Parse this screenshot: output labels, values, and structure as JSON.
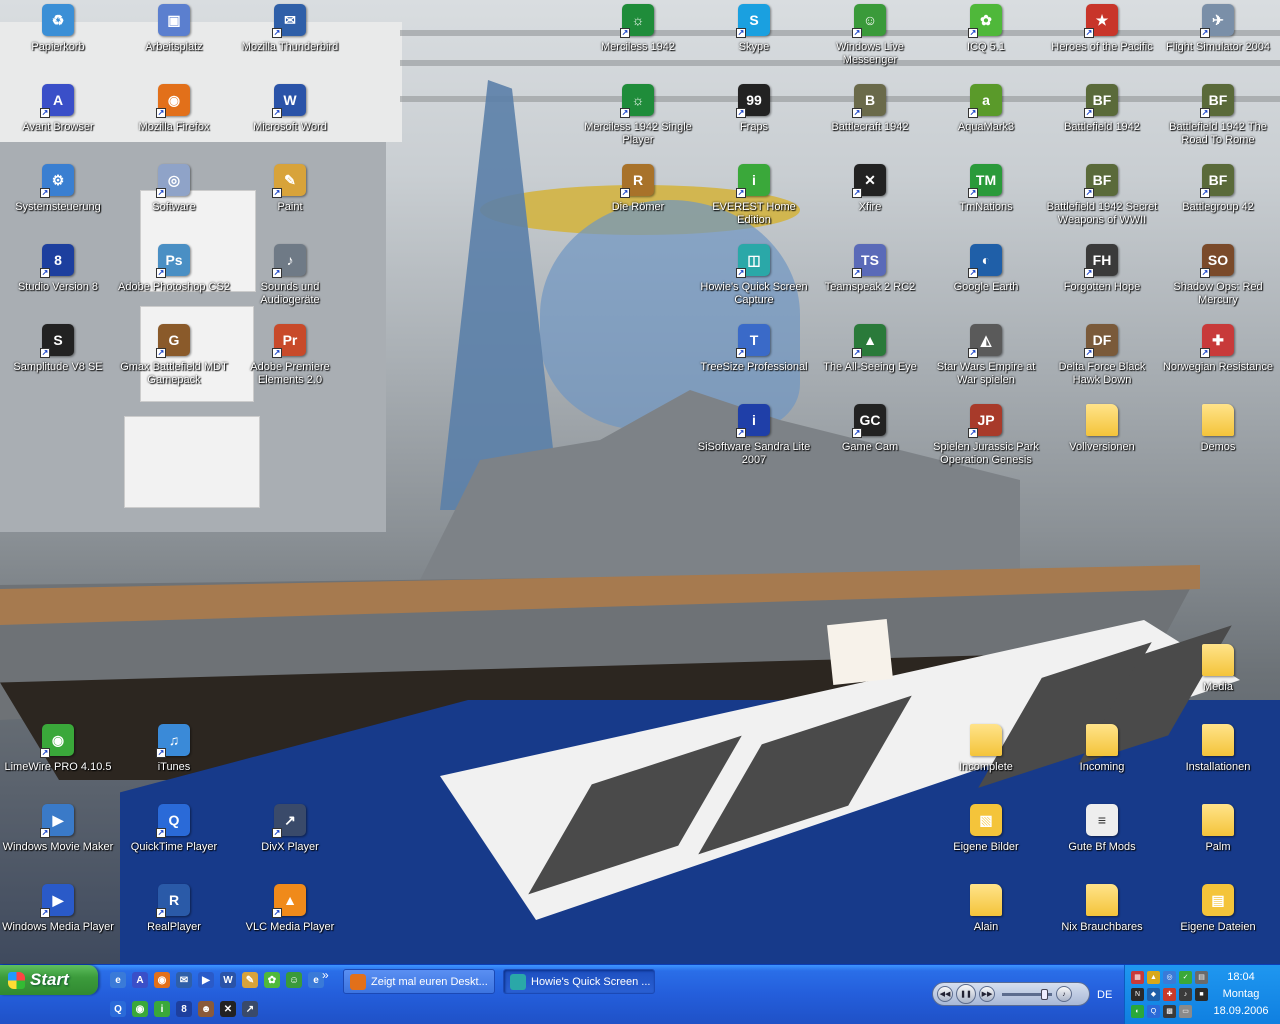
{
  "desktop": {
    "icons": [
      {
        "label": "Papierkorb",
        "icon": "recycle-bin-icon",
        "color": "#3b8fd6",
        "glyph": "♻",
        "shortcut": false
      },
      {
        "label": "Arbeitsplatz",
        "icon": "my-computer-icon",
        "color": "#5b7fcf",
        "glyph": "▣",
        "shortcut": false
      },
      {
        "label": "Mozilla Thunderbird",
        "icon": "thunderbird-icon",
        "color": "#2f5fa8",
        "glyph": "✉",
        "shortcut": true
      },
      {
        "label": "Avant Browser",
        "icon": "avant-browser-icon",
        "color": "#3a4fc8",
        "glyph": "A",
        "shortcut": true
      },
      {
        "label": "Mozilla Firefox",
        "icon": "firefox-icon",
        "color": "#e2701a",
        "glyph": "◉",
        "shortcut": true
      },
      {
        "label": "Microsoft Word",
        "icon": "word-icon",
        "color": "#2a53a8",
        "glyph": "W",
        "shortcut": true
      },
      {
        "label": "Systemsteuerung",
        "icon": "control-panel-icon",
        "color": "#3a7fd1",
        "glyph": "⚙",
        "shortcut": true
      },
      {
        "label": "Software",
        "icon": "software-cd-icon",
        "color": "#8fa3c8",
        "glyph": "◎",
        "shortcut": true
      },
      {
        "label": "Paint",
        "icon": "paint-icon",
        "color": "#d8a33a",
        "glyph": "✎",
        "shortcut": true
      },
      {
        "label": "Studio Version 8",
        "icon": "studio-icon",
        "color": "#1d3f9e",
        "glyph": "8",
        "shortcut": true
      },
      {
        "label": "Adobe Photoshop CS2",
        "icon": "photoshop-icon",
        "color": "#4a8fc4",
        "glyph": "Ps",
        "shortcut": true
      },
      {
        "label": "Sounds und Audiogeräte",
        "icon": "speaker-icon",
        "color": "#6f7a86",
        "glyph": "♪",
        "shortcut": true
      },
      {
        "label": "Samplitude V8 SE",
        "icon": "samplitude-icon",
        "color": "#222222",
        "glyph": "S",
        "shortcut": true
      },
      {
        "label": "Gmax Battlefield MDT Gamepack",
        "icon": "gmax-icon",
        "color": "#8a5a2a",
        "glyph": "G",
        "shortcut": true
      },
      {
        "label": "Adobe Premiere Elements 2.0",
        "icon": "premiere-icon",
        "color": "#c84a2a",
        "glyph": "Pr",
        "shortcut": true
      },
      {
        "label": "Merciless 1942",
        "icon": "merciless-icon",
        "color": "#1f8c3a",
        "glyph": "☼",
        "shortcut": true
      },
      {
        "label": "Skype",
        "icon": "skype-icon",
        "color": "#1aa0e0",
        "glyph": "S",
        "shortcut": true
      },
      {
        "label": "Windows Live Messenger",
        "icon": "messenger-icon",
        "color": "#3a9a3a",
        "glyph": "☺",
        "shortcut": true
      },
      {
        "label": "ICQ 5.1",
        "icon": "icq-icon",
        "color": "#4fb83a",
        "glyph": "✿",
        "shortcut": true
      },
      {
        "label": "Heroes of the Pacific",
        "icon": "heroes-pacific-icon",
        "color": "#c8352a",
        "glyph": "★",
        "shortcut": true
      },
      {
        "label": "Flight Simulator 2004",
        "icon": "flight-sim-icon",
        "color": "#7a8fa8",
        "glyph": "✈",
        "shortcut": true
      },
      {
        "label": "Merciless 1942 Single Player",
        "icon": "merciless-sp-icon",
        "color": "#1f8c3a",
        "glyph": "☼",
        "shortcut": true
      },
      {
        "label": "Fraps",
        "icon": "fraps-icon",
        "color": "#222222",
        "glyph": "99",
        "shortcut": true
      },
      {
        "label": "Battlecraft 1942",
        "icon": "battlecraft-icon",
        "color": "#6a6a4a",
        "glyph": "B",
        "shortcut": true
      },
      {
        "label": "AquaMark3",
        "icon": "aquamark-icon",
        "color": "#5a9a2a",
        "glyph": "a",
        "shortcut": true
      },
      {
        "label": "Battlefield 1942",
        "icon": "bf1942-icon",
        "color": "#5a6a3a",
        "glyph": "BF",
        "shortcut": true
      },
      {
        "label": "Battlefield 1942 The Road To Rome",
        "icon": "bf-road-to-rome-icon",
        "color": "#5a6a3a",
        "glyph": "BF",
        "shortcut": true
      },
      {
        "label": "Die Römer",
        "icon": "die-roemer-icon",
        "color": "#a8722a",
        "glyph": "R",
        "shortcut": true
      },
      {
        "label": "EVEREST Home Edition",
        "icon": "everest-icon",
        "color": "#3aa83a",
        "glyph": "i",
        "shortcut": true
      },
      {
        "label": "Xfire",
        "icon": "xfire-icon",
        "color": "#222222",
        "glyph": "✕",
        "shortcut": true
      },
      {
        "label": "TmNations",
        "icon": "tmnations-icon",
        "color": "#2a9a3a",
        "glyph": "TM",
        "shortcut": true
      },
      {
        "label": "Battlefield 1942 Secret Weapons of WWII",
        "icon": "bf-secret-weapons-icon",
        "color": "#5a6a3a",
        "glyph": "BF",
        "shortcut": true
      },
      {
        "label": "Battlegroup 42",
        "icon": "battlegroup-icon",
        "color": "#5a6a3a",
        "glyph": "BF",
        "shortcut": true
      },
      {
        "label": "Howie's Quick Screen Capture",
        "icon": "screen-capture-icon",
        "color": "#2aa8a8",
        "glyph": "◫",
        "shortcut": true
      },
      {
        "label": "Teamspeak 2 RC2",
        "icon": "teamspeak-icon",
        "color": "#5a6ab8",
        "glyph": "TS",
        "shortcut": true
      },
      {
        "label": "Google Earth",
        "icon": "google-earth-icon",
        "color": "#1f5fa8",
        "glyph": "◐",
        "shortcut": true
      },
      {
        "label": "Forgotten Hope",
        "icon": "forgotten-hope-icon",
        "color": "#3a3a3a",
        "glyph": "FH",
        "shortcut": true
      },
      {
        "label": "Shadow Ops: Red Mercury",
        "icon": "shadow-ops-icon",
        "color": "#7a4a2a",
        "glyph": "SO",
        "shortcut": true
      },
      {
        "label": "TreeSize Professional",
        "icon": "treesize-icon",
        "color": "#3a6ac8",
        "glyph": "T",
        "shortcut": true
      },
      {
        "label": "The All-Seeing Eye",
        "icon": "all-seeing-eye-icon",
        "color": "#2a7a3a",
        "glyph": "▲",
        "shortcut": true
      },
      {
        "label": "Star Wars Empire at War spielen",
        "icon": "empire-at-war-icon",
        "color": "#5a5a5a",
        "glyph": "◭",
        "shortcut": true
      },
      {
        "label": "Delta Force Black Hawk Down",
        "icon": "delta-force-icon",
        "color": "#7a5a3a",
        "glyph": "DF",
        "shortcut": true
      },
      {
        "label": "Norwegian Resistance",
        "icon": "norwegian-resistance-icon",
        "color": "#c83a3a",
        "glyph": "✚",
        "shortcut": true
      },
      {
        "label": "SiSoftware Sandra Lite 2007",
        "icon": "sandra-icon",
        "color": "#1f3fa8",
        "glyph": "i",
        "shortcut": true
      },
      {
        "label": "Game Cam",
        "icon": "game-cam-icon",
        "color": "#222222",
        "glyph": "GC",
        "shortcut": true
      },
      {
        "label": "Spielen Jurassic Park Operation Genesis",
        "icon": "jurassic-park-icon",
        "color": "#a83a2a",
        "glyph": "JP",
        "shortcut": true
      },
      {
        "label": "Vollversionen",
        "icon": "folder-icon",
        "color": "#f4c43a",
        "glyph": "",
        "shortcut": false
      },
      {
        "label": "Demos",
        "icon": "folder-icon",
        "color": "#f4c43a",
        "glyph": "",
        "shortcut": false
      },
      {
        "label": "Media",
        "icon": "folder-icon",
        "color": "#f4c43a",
        "glyph": "",
        "shortcut": false
      },
      {
        "label": "LimeWire PRO 4.10.5",
        "icon": "limewire-icon",
        "color": "#3aa83a",
        "glyph": "◉",
        "shortcut": true
      },
      {
        "label": "iTunes",
        "icon": "itunes-icon",
        "color": "#3a8ad8",
        "glyph": "♫",
        "shortcut": true
      },
      {
        "label": "Incomplete",
        "icon": "folder-icon",
        "color": "#f4c43a",
        "glyph": "",
        "shortcut": false
      },
      {
        "label": "Incoming",
        "icon": "folder-icon",
        "color": "#f4c43a",
        "glyph": "",
        "shortcut": false
      },
      {
        "label": "Installationen",
        "icon": "folder-icon",
        "color": "#f4c43a",
        "glyph": "",
        "shortcut": false
      },
      {
        "label": "Windows Movie Maker",
        "icon": "movie-maker-icon",
        "color": "#3a7ac8",
        "glyph": "▶",
        "shortcut": true
      },
      {
        "label": "QuickTime Player",
        "icon": "quicktime-icon",
        "color": "#2a6ad8",
        "glyph": "Q",
        "shortcut": true
      },
      {
        "label": "DivX Player",
        "icon": "divx-icon",
        "color": "#3a4a6a",
        "glyph": "↗",
        "shortcut": true
      },
      {
        "label": "Eigene Bilder",
        "icon": "my-pictures-icon",
        "color": "#f4c43a",
        "glyph": "▧",
        "shortcut": false
      },
      {
        "label": "Gute Bf Mods",
        "icon": "text-document-icon",
        "color": "#eeeeee",
        "glyph": "≡",
        "shortcut": false
      },
      {
        "label": "Palm",
        "icon": "folder-icon",
        "color": "#f4c43a",
        "glyph": "",
        "shortcut": false
      },
      {
        "label": "Windows Media Player",
        "icon": "media-player-icon",
        "color": "#2a5ac8",
        "glyph": "▶",
        "shortcut": true
      },
      {
        "label": "RealPlayer",
        "icon": "realplayer-icon",
        "color": "#2a5aa8",
        "glyph": "R",
        "shortcut": true
      },
      {
        "label": "VLC Media Player",
        "icon": "vlc-icon",
        "color": "#f08a1a",
        "glyph": "▲",
        "shortcut": true
      },
      {
        "label": "Alain",
        "icon": "folder-icon",
        "color": "#f4c43a",
        "glyph": "",
        "shortcut": false
      },
      {
        "label": "Nix Brauchbares",
        "icon": "folder-icon",
        "color": "#f4c43a",
        "glyph": "",
        "shortcut": false
      },
      {
        "label": "Eigene Dateien",
        "icon": "my-documents-icon",
        "color": "#f4c43a",
        "glyph": "▤",
        "shortcut": false
      }
    ]
  },
  "taskbar": {
    "start_label": "Start",
    "quicklaunch": [
      {
        "icon": "ie-icon",
        "color": "#3a7ad8",
        "glyph": "e"
      },
      {
        "icon": "avant-browser-icon",
        "color": "#3a4fc8",
        "glyph": "A"
      },
      {
        "icon": "firefox-icon",
        "color": "#e2701a",
        "glyph": "◉"
      },
      {
        "icon": "thunderbird-icon",
        "color": "#2f5fa8",
        "glyph": "✉"
      },
      {
        "icon": "media-player-icon",
        "color": "#2a5ac8",
        "glyph": "▶"
      },
      {
        "icon": "word-icon",
        "color": "#2a53a8",
        "glyph": "W"
      },
      {
        "icon": "paint-icon",
        "color": "#d8a33a",
        "glyph": "✎"
      },
      {
        "icon": "icq-icon",
        "color": "#4fb83a",
        "glyph": "✿"
      },
      {
        "icon": "messenger-icon",
        "color": "#3a9a3a",
        "glyph": "☺"
      },
      {
        "icon": "ie-icon",
        "color": "#3a7ad8",
        "glyph": "e"
      },
      {
        "icon": "quicktime-icon",
        "color": "#2a6ad8",
        "glyph": "Q"
      },
      {
        "icon": "limewire-icon",
        "color": "#3aa83a",
        "glyph": "◉"
      },
      {
        "icon": "everest-icon",
        "color": "#3aa83a",
        "glyph": "i"
      },
      {
        "icon": "studio-icon",
        "color": "#1d3f9e",
        "glyph": "8"
      },
      {
        "icon": "user-icon",
        "color": "#8a5a3a",
        "glyph": "☻"
      },
      {
        "icon": "xfire-icon",
        "color": "#222222",
        "glyph": "✕"
      },
      {
        "icon": "divx-icon",
        "color": "#3a4a6a",
        "glyph": "↗"
      }
    ],
    "quicklaunch_more": "»",
    "tasks": [
      {
        "label": "Zeigt mal euren Deskt...",
        "icon": "firefox-icon",
        "color": "#e2701a",
        "active": false
      },
      {
        "label": "Howie's Quick Screen ...",
        "icon": "screen-capture-icon",
        "color": "#2aa8a8",
        "active": true
      }
    ],
    "media_bar": {
      "prev": "◀◀",
      "pause": "❚❚",
      "next": "▶▶",
      "volume": 0.9
    },
    "language": "DE",
    "tray_icons": [
      {
        "icon": "flag-icon",
        "color": "#c83a3a",
        "glyph": "▦"
      },
      {
        "icon": "warning-icon",
        "color": "#d8a81a",
        "glyph": "▲"
      },
      {
        "icon": "network-icon",
        "color": "#3a7ad8",
        "glyph": "◎"
      },
      {
        "icon": "security-icon",
        "color": "#3aa83a",
        "glyph": "✓"
      },
      {
        "icon": "wireless-icon",
        "color": "#6a6a6a",
        "glyph": "▤"
      },
      {
        "icon": "nvidia-icon",
        "color": "#2a2a2a",
        "glyph": "N"
      },
      {
        "icon": "shield-icon",
        "color": "#1f5fa8",
        "glyph": "◆"
      },
      {
        "icon": "firewall-icon",
        "color": "#c83a2a",
        "glyph": "✚"
      },
      {
        "icon": "volume-icon",
        "color": "#3a3a3a",
        "glyph": "♪"
      },
      {
        "icon": "monitor-icon",
        "color": "#2a2a2a",
        "glyph": "■"
      },
      {
        "icon": "antivirus-icon",
        "color": "#2aa83a",
        "glyph": "◐"
      },
      {
        "icon": "quicktime-icon",
        "color": "#2a6ad8",
        "glyph": "Q"
      },
      {
        "icon": "cpu-icon",
        "color": "#3a3a3a",
        "glyph": "▩"
      },
      {
        "icon": "drive-icon",
        "color": "#8a8a8a",
        "glyph": "▭"
      }
    ],
    "clock": {
      "time": "18:04",
      "day": "Montag",
      "date": "18.09.2006"
    }
  }
}
